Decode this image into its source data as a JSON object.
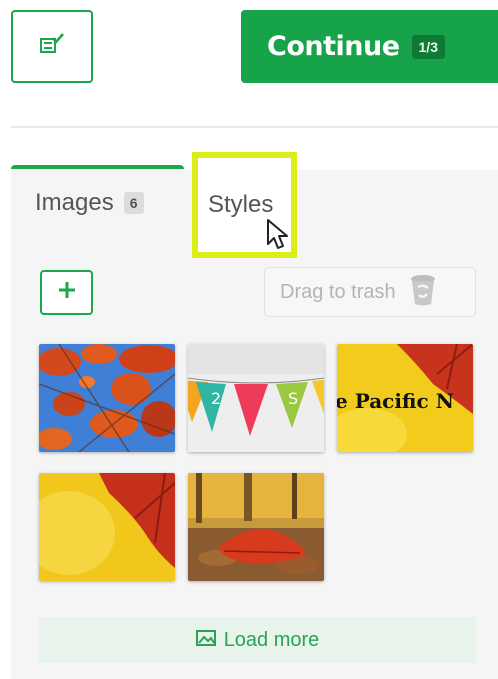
{
  "header": {
    "checklist_icon": "checklist-icon",
    "continue_label": "Continue",
    "step_indicator": "1/3"
  },
  "tabs": [
    {
      "label": "Images",
      "count": "6",
      "active": true
    },
    {
      "label": "Styles",
      "active": false
    }
  ],
  "toolbar": {
    "add_icon": "plus-icon",
    "trash_label": "Drag to trash",
    "trash_icon": "trash-icon"
  },
  "thumbnails": [
    {
      "name": "autumn-leaves-sky",
      "caption": ""
    },
    {
      "name": "bunting-banner",
      "caption": "",
      "pennants": [
        "2",
        "",
        "S"
      ]
    },
    {
      "name": "pacific-nw-leaf-text",
      "caption": "e Pacific N"
    },
    {
      "name": "red-leaf-yellow",
      "caption": ""
    },
    {
      "name": "fallen-leaf-ground",
      "caption": ""
    }
  ],
  "load_more": {
    "label": "Load more",
    "icon": "image-icon"
  },
  "colors": {
    "accent": "#16a34a",
    "highlight": "#dced17",
    "panel_bg": "#f5f5f5"
  }
}
